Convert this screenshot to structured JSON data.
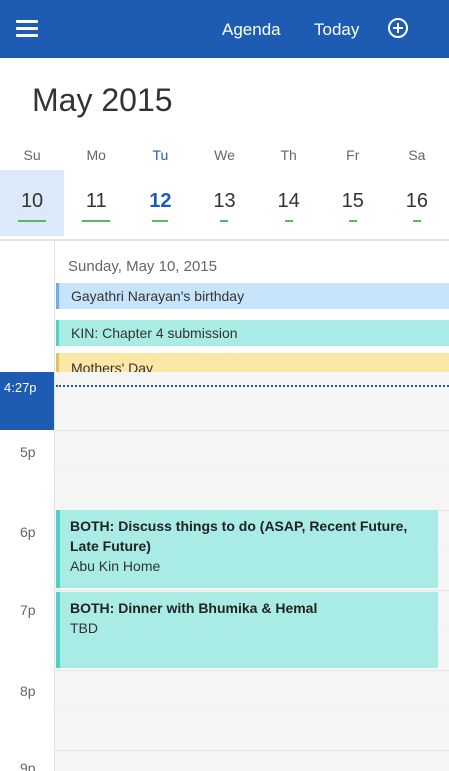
{
  "header": {
    "agenda_label": "Agenda",
    "today_label": "Today",
    "menu_icon": "hamburger-icon",
    "add_icon": "add-circle-icon"
  },
  "month_title": "May 2015",
  "weekdays": [
    "Su",
    "Mo",
    "Tu",
    "We",
    "Th",
    "Fr",
    "Sa"
  ],
  "days": [
    "10",
    "11",
    "12",
    "13",
    "14",
    "15",
    "16"
  ],
  "selected_day": "10",
  "today_day": "12",
  "day_view": {
    "date_label": "Sunday, May 10, 2015",
    "all_day_events": [
      "Gayathri Narayan's birthday",
      "KIN: Chapter 4 submission",
      "Mothers' Day"
    ],
    "current_time": "4:27p",
    "hours": [
      "5p",
      "6p",
      "7p",
      "8p",
      "9p"
    ],
    "events": [
      {
        "title": "BOTH: Discuss things to do (ASAP, Recent Future, Late Future)",
        "location": "Abu Kin Home"
      },
      {
        "title": "BOTH: Dinner with Bhumika & Hemal",
        "location": "TBD"
      }
    ]
  },
  "colors": {
    "accent": "#1e5bb3",
    "event_teal": "#a9ece5",
    "event_blue": "#c8e4fb",
    "event_yellow": "#fbe7a6"
  }
}
